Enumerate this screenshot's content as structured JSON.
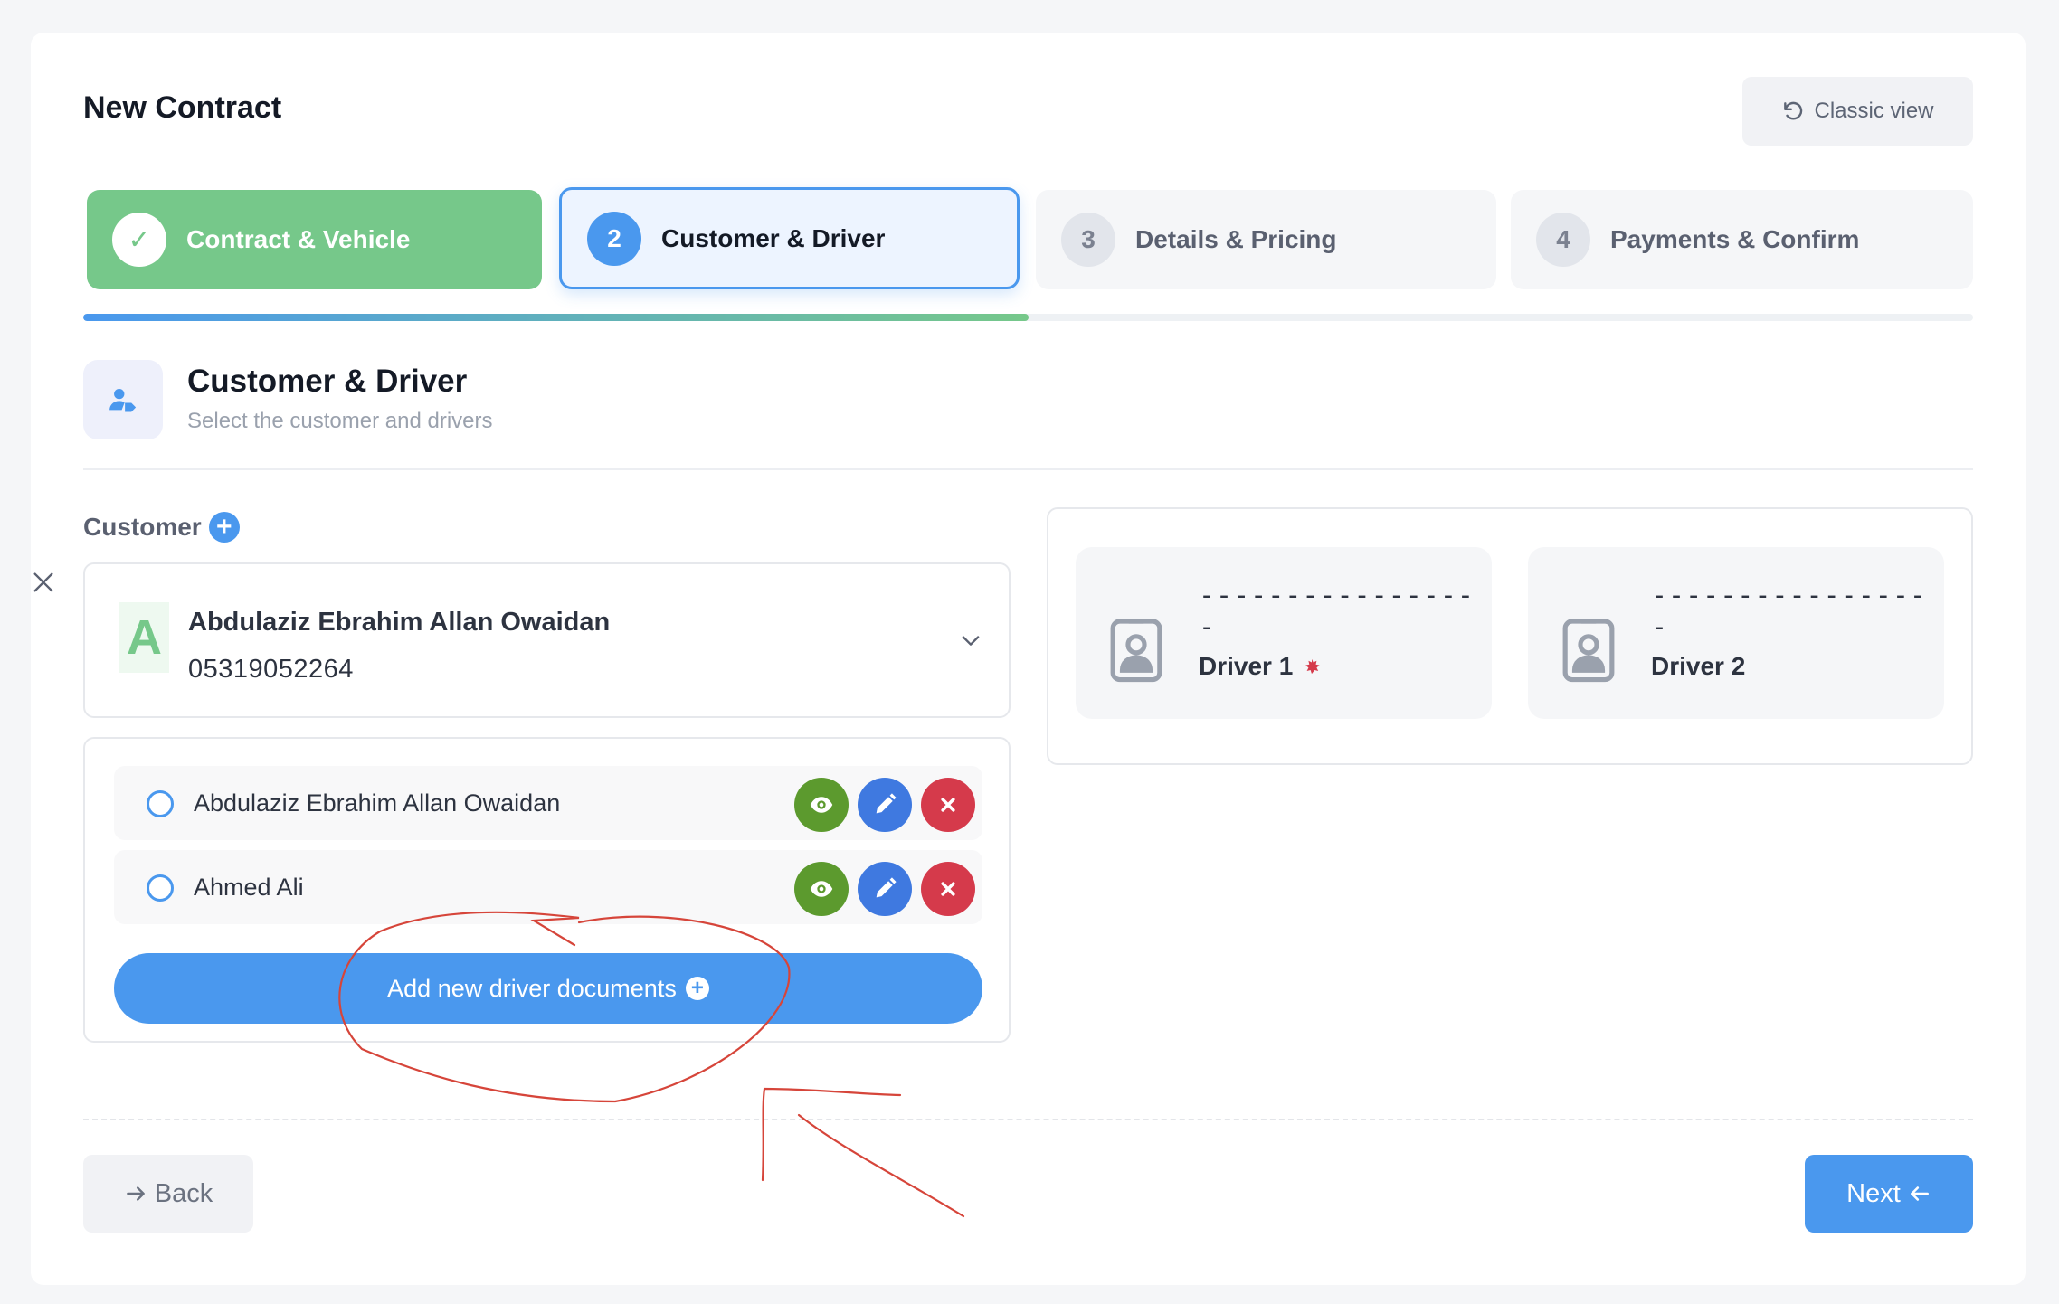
{
  "page": {
    "title": "New Contract",
    "classic_view_label": "Classic view"
  },
  "stepper": {
    "steps": [
      {
        "number": "✓",
        "label": "Contract & Vehicle",
        "state": "completed"
      },
      {
        "number": "2",
        "label": "Customer & Driver",
        "state": "active"
      },
      {
        "number": "3",
        "label": "Details & Pricing",
        "state": "pending"
      },
      {
        "number": "4",
        "label": "Payments & Confirm",
        "state": "pending"
      }
    ],
    "progress_fraction": 0.5
  },
  "section": {
    "icon": "user-tag-icon",
    "title": "Customer & Driver",
    "subtitle": "Select the customer and drivers"
  },
  "customer": {
    "label": "Customer",
    "selected": {
      "initial": "A",
      "name": "Abdulaziz Ebrahim Allan Owaidan",
      "phone": "05319052264"
    }
  },
  "drivers_list": {
    "items": [
      {
        "name": "Abdulaziz Ebrahim Allan Owaidan"
      },
      {
        "name": "Ahmed Ali"
      }
    ],
    "add_button_label": "Add new driver documents"
  },
  "driver_slots": [
    {
      "placeholder": "-----------------",
      "label": "Driver 1",
      "required": true
    },
    {
      "placeholder": "-----------------",
      "label": "Driver 2",
      "required": false
    }
  ],
  "footer": {
    "back_label": "Back",
    "next_label": "Next"
  },
  "colors": {
    "primary": "#4a98ee",
    "success": "#76c88a",
    "view": "#5c9a2e",
    "edit": "#3f79e0",
    "delete": "#d53a4b",
    "annotation": "#d6453a"
  }
}
